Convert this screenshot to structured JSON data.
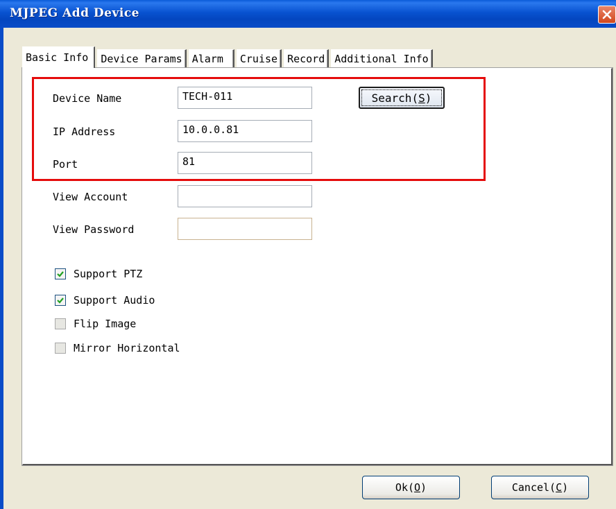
{
  "window": {
    "title": "MJPEG Add Device",
    "close_icon": "close-icon"
  },
  "tabs": [
    {
      "label": "Basic Info",
      "active": true
    },
    {
      "label": "Device Params",
      "active": false
    },
    {
      "label": "Alarm",
      "active": false
    },
    {
      "label": "Cruise",
      "active": false
    },
    {
      "label": "Record",
      "active": false
    },
    {
      "label": "Additional Info",
      "active": false
    }
  ],
  "form": {
    "device_name_label": "Device Name",
    "device_name_value": "TECH-011",
    "ip_label": "IP Address",
    "ip_value": "10.0.0.81",
    "port_label": "Port",
    "port_value": "81",
    "view_account_label": "View Account",
    "view_account_value": "",
    "view_password_label": "View Password",
    "view_password_value": "",
    "search_label": "Search",
    "search_hotkey": "S"
  },
  "options": [
    {
      "label": "Support PTZ",
      "checked": true
    },
    {
      "label": "Support Audio",
      "checked": true
    },
    {
      "label": "Flip Image",
      "checked": false
    },
    {
      "label": "Mirror Horizontal",
      "checked": false
    }
  ],
  "buttons": {
    "ok_label": "Ok",
    "ok_hotkey": "O",
    "cancel_label": "Cancel",
    "cancel_hotkey": "C"
  },
  "colors": {
    "highlight": "#e50c0c",
    "titlebar": "#0852d0",
    "check": "#21a121"
  }
}
